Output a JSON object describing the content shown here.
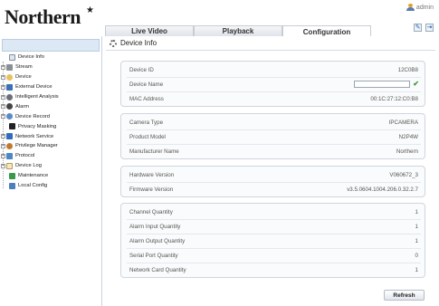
{
  "header": {
    "logo": "Northern",
    "user": "admin",
    "tabs": [
      {
        "label": "Live Video",
        "active": false
      },
      {
        "label": "Playback",
        "active": false
      },
      {
        "label": "Configuration",
        "active": true
      }
    ],
    "buttons": [
      {
        "icon": "edit-icon"
      },
      {
        "icon": "logout-icon"
      }
    ]
  },
  "sidebar": {
    "items": [
      {
        "label": "Device Info",
        "icon": "device-info-icon",
        "expandable": false,
        "level": 2
      },
      {
        "label": "Stream",
        "icon": "stream-icon",
        "expandable": true,
        "level": 1
      },
      {
        "label": "Device",
        "icon": "device-icon",
        "expandable": true,
        "level": 1
      },
      {
        "label": "External Device",
        "icon": "external-device-icon",
        "expandable": true,
        "level": 1
      },
      {
        "label": "Intelligent Analysis",
        "icon": "intelligent-analysis-icon",
        "expandable": true,
        "level": 1
      },
      {
        "label": "Alarm",
        "icon": "alarm-icon",
        "expandable": true,
        "level": 1
      },
      {
        "label": "Device Record",
        "icon": "device-record-icon",
        "expandable": true,
        "level": 1
      },
      {
        "label": "Privacy Masking",
        "icon": "privacy-masking-icon",
        "expandable": false,
        "level": 2
      },
      {
        "label": "Network Service",
        "icon": "network-service-icon",
        "expandable": true,
        "level": 1
      },
      {
        "label": "Privilege Manager",
        "icon": "privilege-manager-icon",
        "expandable": true,
        "level": 1
      },
      {
        "label": "Protocol",
        "icon": "protocol-icon",
        "expandable": true,
        "level": 1
      },
      {
        "label": "Device Log",
        "icon": "device-log-icon",
        "expandable": true,
        "level": 1
      },
      {
        "label": "Maintenance",
        "icon": "maintenance-icon",
        "expandable": false,
        "level": 2
      },
      {
        "label": "Local Config",
        "icon": "local-config-icon",
        "expandable": false,
        "level": 2
      }
    ]
  },
  "main": {
    "title": "Device Info",
    "groups": [
      {
        "rows": [
          {
            "label": "Device ID",
            "value": "12C0B8"
          },
          {
            "label": "Device Name",
            "value": "",
            "editable": true
          },
          {
            "label": "MAC Address",
            "value": "00:1C:27:12:C0:B8"
          }
        ]
      },
      {
        "rows": [
          {
            "label": "Camera Type",
            "value": "IPCAMERA"
          },
          {
            "label": "Product Model",
            "value": "N2P4W"
          },
          {
            "label": "Manufacturer Name",
            "value": "Northern"
          }
        ]
      },
      {
        "rows": [
          {
            "label": "Hardware Version",
            "value": "V060672_3"
          },
          {
            "label": "Firmware Version",
            "value": "v3.5.0604.1004.206.0.32.2.7"
          }
        ]
      },
      {
        "rows": [
          {
            "label": "Channel Quantity",
            "value": "1"
          },
          {
            "label": "Alarm Input Quantity",
            "value": "1"
          },
          {
            "label": "Alarm Output Quantity",
            "value": "1"
          },
          {
            "label": "Serial Port Quantity",
            "value": "0"
          },
          {
            "label": "Network Card Quantity",
            "value": "1"
          }
        ]
      }
    ],
    "refresh_label": "Refresh"
  }
}
